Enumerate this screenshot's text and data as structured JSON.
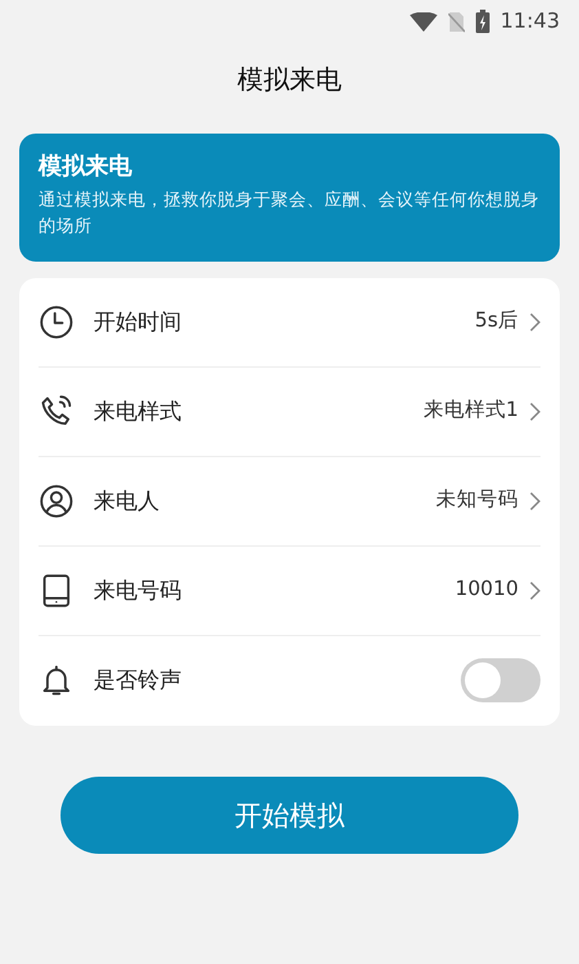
{
  "status_bar": {
    "time": "11:43"
  },
  "title": "模拟来电",
  "banner": {
    "heading": "模拟来电",
    "text": "通过模拟来电，拯救你脱身于聚会、应酬、会议等任何你想脱身的场所"
  },
  "settings": [
    {
      "kind": "link",
      "label": "开始时间",
      "value": "5s后"
    },
    {
      "kind": "link",
      "label": "来电样式",
      "value": "来电样式1"
    },
    {
      "kind": "link",
      "label": "来电人",
      "value": "未知号码"
    },
    {
      "kind": "link",
      "label": "来电号码",
      "value": "10010"
    },
    {
      "kind": "toggle",
      "label": "是否铃声",
      "on": false
    }
  ],
  "button": "开始模拟"
}
